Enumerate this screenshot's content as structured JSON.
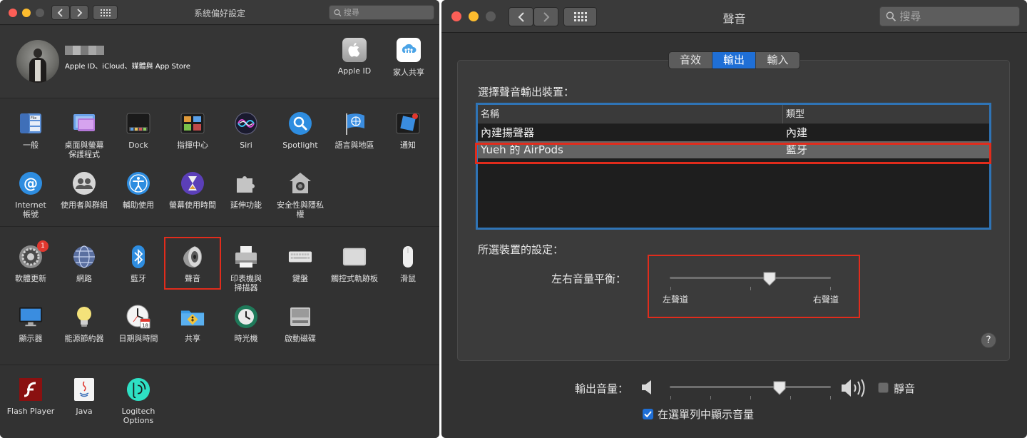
{
  "left_window": {
    "title": "系統偏好設定",
    "search_placeholder": "搜尋",
    "account": {
      "subtitle": "Apple ID、iCloud、媒體與 App Store",
      "items": [
        {
          "label": "Apple ID",
          "icon": "apple-id-icon"
        },
        {
          "label": "家人共享",
          "icon": "family-sharing-icon"
        }
      ]
    },
    "section1": [
      {
        "label": "一般",
        "icon": "general-icon"
      },
      {
        "label": "桌面與螢幕\n保護程式",
        "icon": "desktop-screensaver-icon"
      },
      {
        "label": "Dock",
        "icon": "dock-icon"
      },
      {
        "label": "指揮中心",
        "icon": "mission-control-icon"
      },
      {
        "label": "Siri",
        "icon": "siri-icon"
      },
      {
        "label": "Spotlight",
        "icon": "spotlight-icon"
      },
      {
        "label": "語言與地區",
        "icon": "language-region-icon"
      },
      {
        "label": "通知",
        "icon": "notifications-icon"
      },
      {
        "label": "Internet\n帳號",
        "icon": "internet-accounts-icon"
      },
      {
        "label": "使用者與群組",
        "icon": "users-groups-icon"
      },
      {
        "label": "輔助使用",
        "icon": "accessibility-icon"
      },
      {
        "label": "螢幕使用時間",
        "icon": "screen-time-icon"
      },
      {
        "label": "延伸功能",
        "icon": "extensions-icon"
      },
      {
        "label": "安全性與隱私權",
        "icon": "security-privacy-icon"
      }
    ],
    "section2": [
      {
        "label": "軟體更新",
        "icon": "software-update-icon",
        "badge": "1"
      },
      {
        "label": "網路",
        "icon": "network-icon"
      },
      {
        "label": "藍牙",
        "icon": "bluetooth-icon"
      },
      {
        "label": "聲音",
        "icon": "sound-icon"
      },
      {
        "label": "印表機與\n掃描器",
        "icon": "printers-scanners-icon"
      },
      {
        "label": "鍵盤",
        "icon": "keyboard-icon"
      },
      {
        "label": "觸控式軌跡板",
        "icon": "trackpad-icon"
      },
      {
        "label": "滑鼠",
        "icon": "mouse-icon"
      },
      {
        "label": "顯示器",
        "icon": "displays-icon"
      },
      {
        "label": "能源節約器",
        "icon": "energy-saver-icon"
      },
      {
        "label": "日期與時間",
        "icon": "date-time-icon"
      },
      {
        "label": "共享",
        "icon": "sharing-icon"
      },
      {
        "label": "時光機",
        "icon": "time-machine-icon"
      },
      {
        "label": "啟動磁碟",
        "icon": "startup-disk-icon"
      }
    ],
    "section3": [
      {
        "label": "Flash Player",
        "icon": "flash-player-icon"
      },
      {
        "label": "Java",
        "icon": "java-icon"
      },
      {
        "label": "Logitech Options",
        "icon": "logitech-options-icon"
      }
    ]
  },
  "right_window": {
    "title": "聲音",
    "search_placeholder": "搜尋",
    "tabs": [
      "音效",
      "輸出",
      "輸入"
    ],
    "active_tab": "輸出",
    "select_label": "選擇聲音輸出裝置：",
    "table": {
      "columns": [
        "名稱",
        "類型"
      ],
      "rows": [
        {
          "name": "內建揚聲器",
          "type": "內建"
        },
        {
          "name": "Yueh 的 AirPods",
          "type": "藍牙"
        }
      ],
      "selected_row": 1
    },
    "device_settings_label": "所選裝置的設定：",
    "balance": {
      "label": "左右音量平衡：",
      "left": "左聲道",
      "right": "右聲道",
      "value": 0.62
    },
    "output_volume": {
      "label": "輸出音量：",
      "value": 0.68
    },
    "mute_label": "靜音",
    "mute_checked": false,
    "show_in_menubar_label": "在選單列中顯示音量",
    "show_in_menubar_checked": true,
    "help": "?"
  },
  "colors": {
    "accent": "#1f6fd6",
    "highlight_box": "#e12c1c",
    "table_focus": "#2f74b6",
    "window_bg": "#323232"
  }
}
